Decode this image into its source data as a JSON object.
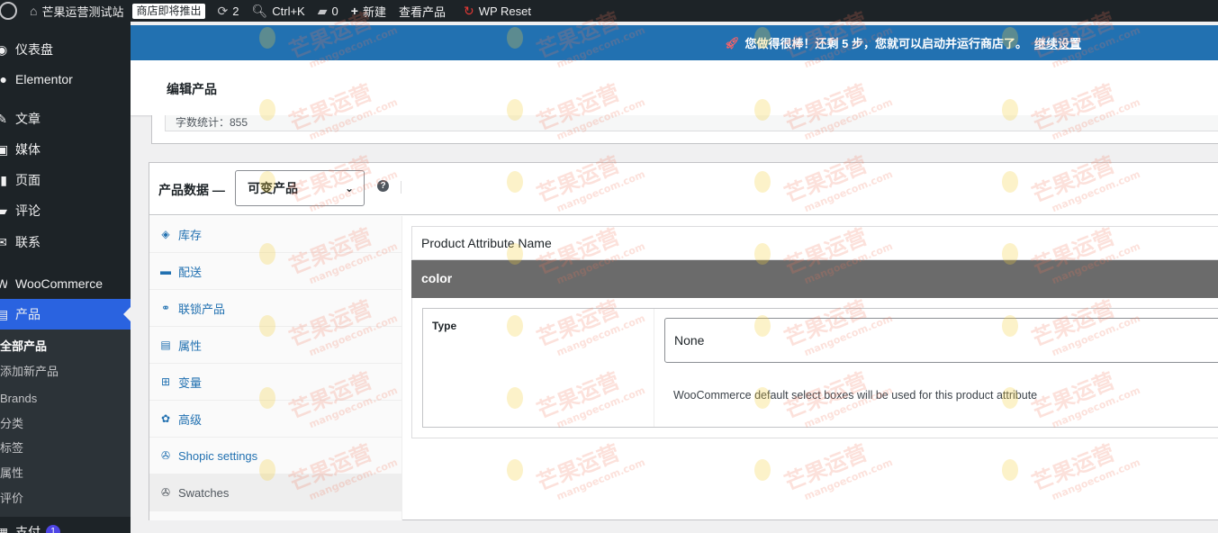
{
  "adminbar": {
    "site_name": "芒果运营测试站",
    "store_badge": "商店即将推出",
    "updates_count": "2",
    "search_shortcut": "Ctrl+K",
    "comments_count": "0",
    "new_label": "新建",
    "view_product_label": "查看产品",
    "wp_reset_label": "WP Reset"
  },
  "sidebar": {
    "items": [
      {
        "label": "仪表盘"
      },
      {
        "label": "Elementor"
      },
      {
        "label": "文章"
      },
      {
        "label": "媒体"
      },
      {
        "label": "页面"
      },
      {
        "label": "评论"
      },
      {
        "label": "联系"
      },
      {
        "label": "WooCommerce"
      },
      {
        "label": "产品"
      }
    ],
    "submenu": [
      {
        "label": "全部产品"
      },
      {
        "label": "添加新产品"
      },
      {
        "label": "Brands"
      },
      {
        "label": "分类"
      },
      {
        "label": "标签"
      },
      {
        "label": "属性"
      },
      {
        "label": "评价"
      }
    ],
    "next_item": {
      "label": "支付",
      "badge": "1"
    }
  },
  "notice": {
    "text": "您做得很棒！还剩 5 步，您就可以启动并运行商店了。",
    "link": "继续设置"
  },
  "header": {
    "title": "编辑产品"
  },
  "word_count": "字数统计：855",
  "product_data": {
    "title": "产品数据 —",
    "type_selected": "可变产品",
    "help": "?",
    "tabs": [
      {
        "label": "库存"
      },
      {
        "label": "配送"
      },
      {
        "label": "联锁产品"
      },
      {
        "label": "属性"
      },
      {
        "label": "变量"
      },
      {
        "label": "高级"
      },
      {
        "label": "Shopic settings"
      },
      {
        "label": "Swatches"
      }
    ]
  },
  "swatches": {
    "attribute_name_header": "Product Attribute Name",
    "attribute": "color",
    "type_label": "Type",
    "type_value": "None",
    "type_description": "WooCommerce default select boxes will be used for this product attribute"
  },
  "watermark": {
    "text": "芒果运营",
    "sub": "mangoecom.com"
  },
  "colors": {
    "admin_dark": "#1d2327",
    "notice_blue": "#2271b1",
    "active_menu": "#2a63e0",
    "link_blue": "#2271b1",
    "attribute_bar": "#6b6b6b"
  }
}
